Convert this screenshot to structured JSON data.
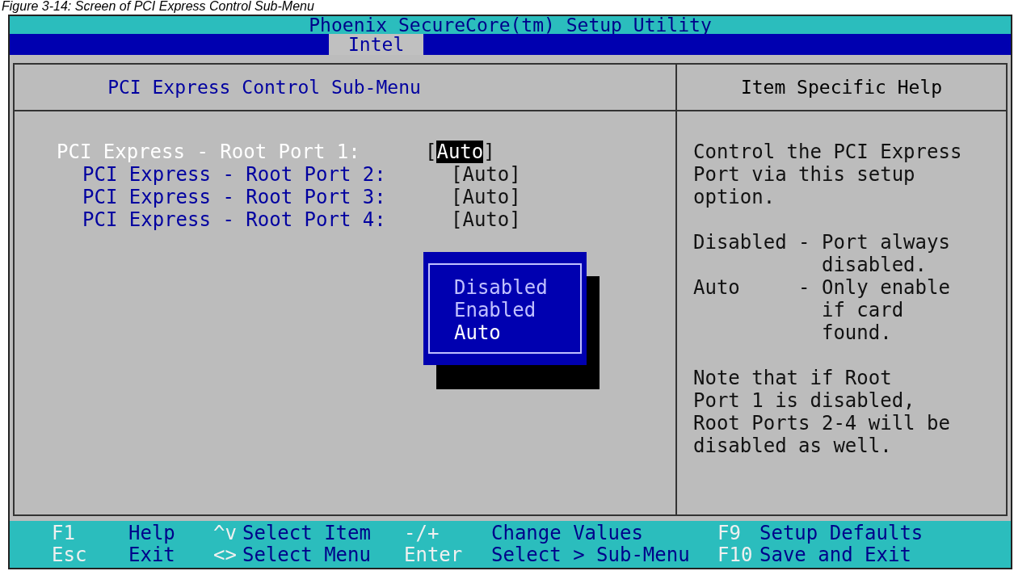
{
  "caption": "Figure 3-14: Screen of PCI Express Control Sub-Menu",
  "window": {
    "title": "Phoenix SecureCore(tm) Setup Utility"
  },
  "tabs": [
    {
      "label": "Intel",
      "selected": true
    }
  ],
  "menu": {
    "title": "PCI Express Control Sub-Menu",
    "items": [
      {
        "label": "PCI Express - Root Port 1:",
        "open": "[",
        "value": "Auto",
        "close": "]",
        "selected": true
      },
      {
        "label": "PCI Express - Root Port 2:",
        "open": "[",
        "value": "Auto",
        "close": "]",
        "selected": false
      },
      {
        "label": "PCI Express - Root Port 3:",
        "open": "[",
        "value": "Auto",
        "close": "]",
        "selected": false
      },
      {
        "label": "PCI Express - Root Port 4:",
        "open": "[",
        "value": "Auto",
        "close": "]",
        "selected": false
      }
    ]
  },
  "popup": {
    "options": [
      {
        "label": "Disabled",
        "selected": false
      },
      {
        "label": "Enabled",
        "selected": false
      },
      {
        "label": "Auto",
        "selected": true
      }
    ]
  },
  "help": {
    "title": "Item Specific Help",
    "paragraphs": [
      "Control the PCI Express\nPort via this setup\noption.",
      "Disabled - Port always\n           disabled.\nAuto     - Only enable\n           if card\n           found.",
      "Note that if Root\nPort 1 is disabled,\nRoot Ports 2-4 will be\ndisabled as well."
    ]
  },
  "footer": [
    [
      {
        "key": "F1",
        "action": "Help"
      },
      {
        "key": "^v",
        "action": "Select Item"
      },
      {
        "key": "-/+",
        "action": "Change Values"
      },
      {
        "key": "F9",
        "action": "Setup Defaults"
      }
    ],
    [
      {
        "key": "Esc",
        "action": "Exit"
      },
      {
        "key": "<>",
        "action": "Select Menu"
      },
      {
        "key": "Enter",
        "action": "Select > Sub-Menu"
      },
      {
        "key": "F10",
        "action": "Save and Exit"
      }
    ]
  ]
}
